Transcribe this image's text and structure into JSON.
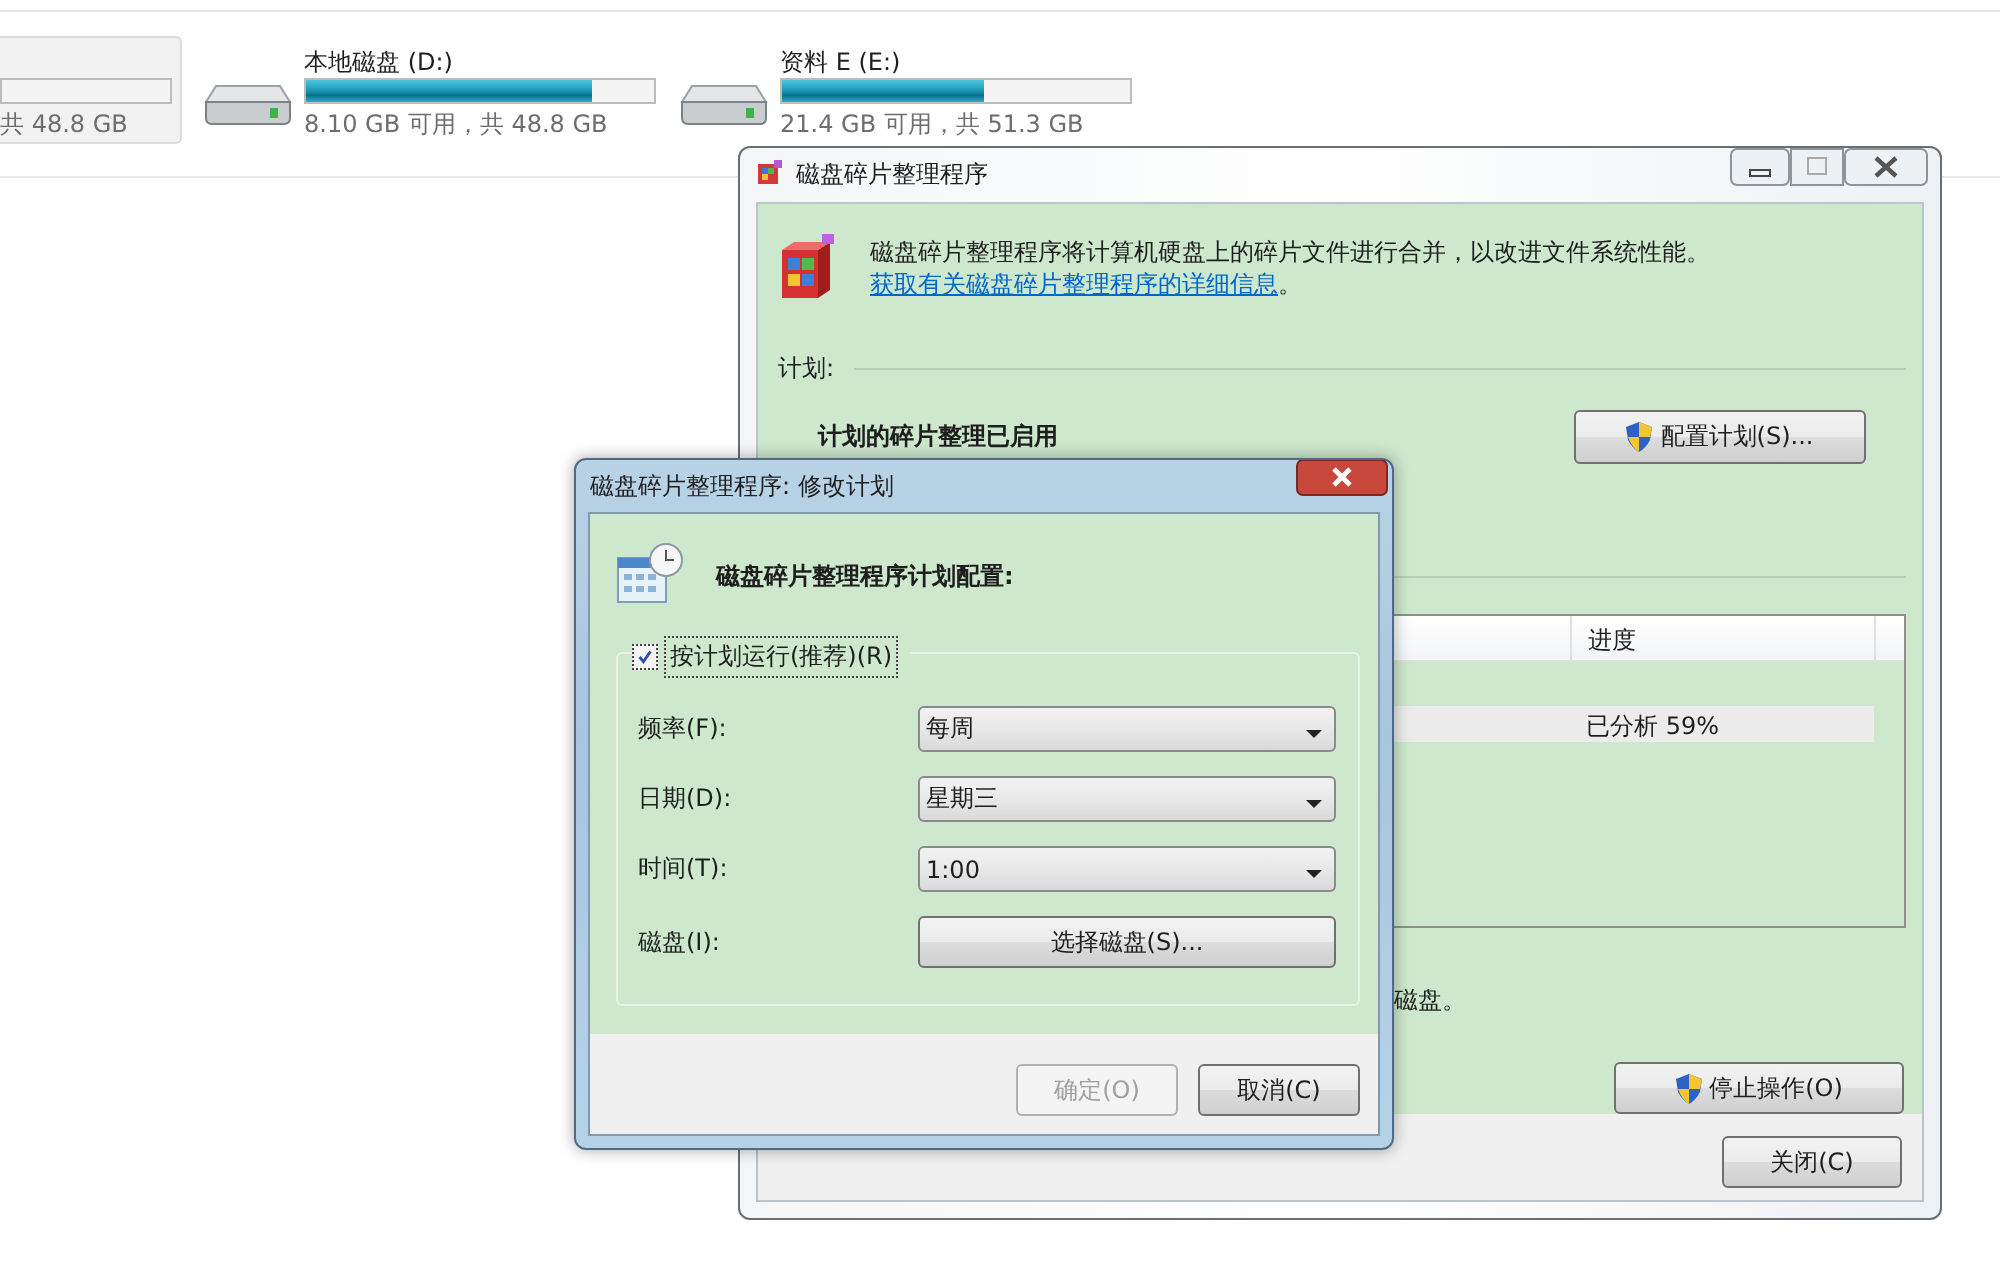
{
  "drives": [
    {
      "kind": "partial",
      "usage": "共 48.8 GB",
      "selected": true
    },
    {
      "kind": "full",
      "name": "本地磁盘 (D:)",
      "level": 0.82,
      "usage": "8.10 GB 可用，共 48.8 GB",
      "selected": false
    },
    {
      "kind": "full",
      "name": "资料 E (E:)",
      "level": 0.58,
      "usage": "21.4 GB 可用，共 51.3 GB",
      "selected": false
    }
  ],
  "defrag_window": {
    "title": "磁盘碎片整理程序",
    "intro": "磁盘碎片整理程序将计算机硬盘上的碎片文件进行合并，以改进文件系统性能。",
    "link": "获取有关磁盘碎片整理程序的详细信息",
    "link_suffix": "。",
    "schedule_heading": "计划:",
    "schedule_status": "计划的碎片整理已启用",
    "configure_button": "配置计划(S)...",
    "table": {
      "columns": [
        "进度"
      ],
      "rows": [
        {
          "progress": "已分析 59%",
          "selected": true
        }
      ]
    },
    "note": "磁盘。",
    "stop_button": "停止操作(O)",
    "close_button": "关闭(C)"
  },
  "schedule_dialog": {
    "title": "磁盘碎片整理程序: 修改计划",
    "heading": "磁盘碎片整理程序计划配置:",
    "run_on_schedule": {
      "label": "按计划运行(推荐)(R)",
      "checked": true
    },
    "fields": [
      {
        "kind": "combo",
        "label": "频率(F):",
        "value": "每周"
      },
      {
        "kind": "combo",
        "label": "日期(D):",
        "value": "星期三"
      },
      {
        "kind": "combo",
        "label": "时间(T):",
        "value": "1:00"
      },
      {
        "kind": "button",
        "label": "磁盘(I):",
        "value": "选择磁盘(S)..."
      }
    ],
    "buttons": [
      {
        "label": "确定(O)",
        "disabled": true
      },
      {
        "label": "取消(C)",
        "disabled": false
      }
    ]
  }
}
